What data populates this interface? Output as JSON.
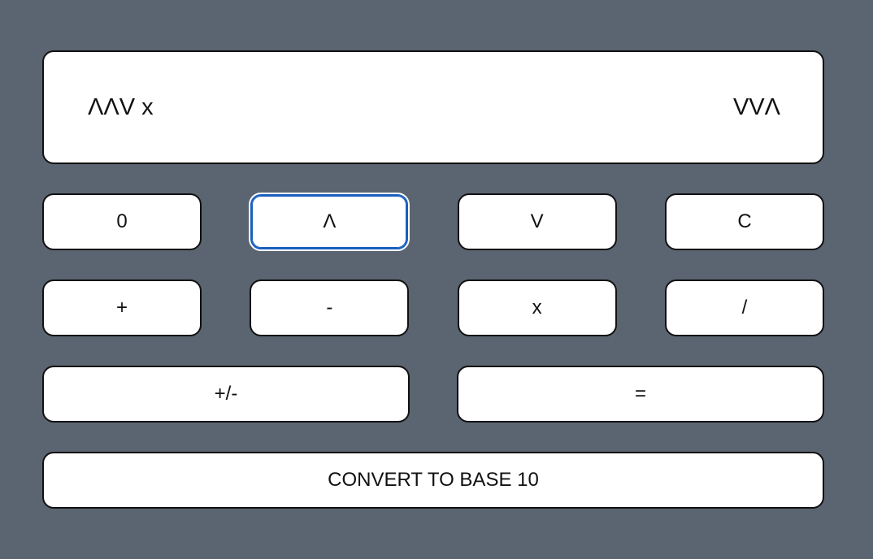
{
  "display": {
    "expression": "ΛΛV x",
    "current": "VVΛ"
  },
  "keypad": {
    "row1": [
      "0",
      "Λ",
      "V",
      "C"
    ],
    "row2": [
      "+",
      "-",
      "x",
      "/"
    ],
    "row3": [
      "+/-",
      "="
    ],
    "convert_label": "CONVERT TO BASE 10"
  },
  "colors": {
    "background": "#5b6571",
    "focus_ring": "#1a5fbf"
  }
}
